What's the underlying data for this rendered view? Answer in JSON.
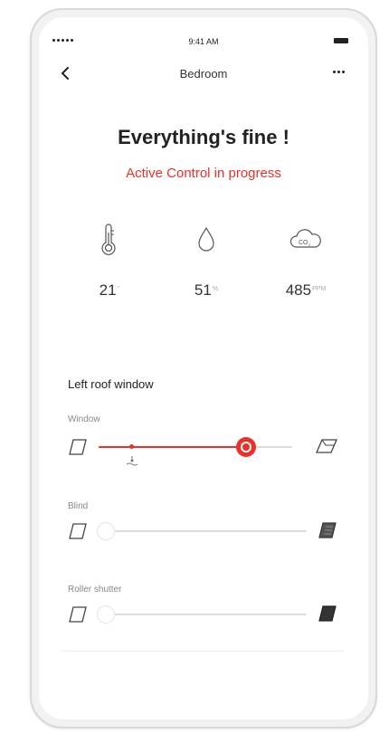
{
  "status_bar": {
    "time": "9:41 AM"
  },
  "nav": {
    "title": "Bedroom"
  },
  "status": {
    "headline": "Everything's fine !",
    "subline": "Active Control in progress"
  },
  "metrics": [
    {
      "icon": "thermometer-icon",
      "value": "21",
      "unit": "°"
    },
    {
      "icon": "humidity-drop-icon",
      "value": "51",
      "unit": "%"
    },
    {
      "icon": "co2-cloud-icon",
      "value": "485",
      "unit": "PPM"
    }
  ],
  "section": {
    "title": "Left roof window"
  },
  "controls": [
    {
      "label": "Window",
      "level": 0.76,
      "marker": 0.17,
      "state": "active"
    },
    {
      "label": "Blind",
      "level": 0.0,
      "state": "inactive"
    },
    {
      "label": "Roller shutter",
      "level": 0.0,
      "state": "inactive"
    }
  ],
  "colors": {
    "accent": "#e8312a",
    "track": "#dcdcdc",
    "text": "#333333"
  }
}
